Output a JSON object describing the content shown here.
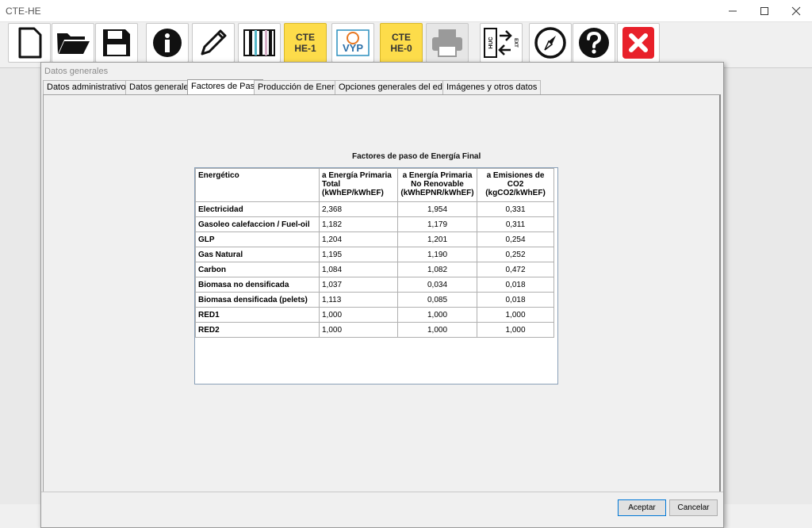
{
  "window": {
    "title": "CTE-HE"
  },
  "toolbar": {
    "cte_he1": "CTE\nHE-1",
    "cte_he0": "CTE\nHE-0",
    "vyp": "VYP",
    "huc": "HUC",
    "ext": "EXT",
    "icons": [
      "new-file-icon",
      "open-folder-icon",
      "save-icon",
      "info-icon",
      "edit-icon",
      "layers-icon",
      "cte-he1-icon",
      "vyp-icon",
      "cte-he0-icon",
      "print-icon",
      "huc-ext-icon",
      "compass-icon",
      "help-icon",
      "close-icon"
    ]
  },
  "dialog": {
    "title": "Datos generales",
    "tabs": [
      "Datos administrativos",
      "Datos generales",
      "Factores de Paso",
      "Producción de Energía",
      "Opciones generales del edificio",
      "Imágenes y otros datos"
    ],
    "active_tab": "Factores de Paso",
    "table_title": "Factores de paso de Energía Final",
    "columns": [
      "Energético",
      "a Energía Primaria Total (kWhEP/kWhEF)",
      "a Energía Primaria No Renovable (kWhEPNR/kWhEF)",
      "a Emisiones de CO2 (kgCO2/kWhEF)"
    ],
    "column_lines": [
      [
        "Energético"
      ],
      [
        "a Energía Primaria",
        "Total",
        "(kWhEP/kWhEF)"
      ],
      [
        "a Energía Primaria",
        "No Renovable",
        "(kWhEPNR/kWhEF)"
      ],
      [
        "a Emisiones de",
        "CO2",
        "(kgCO2/kWhEF)"
      ]
    ],
    "rows": [
      [
        "Electricidad",
        "2,368",
        "1,954",
        "0,331"
      ],
      [
        "Gasoleo calefaccion / Fuel-oil",
        "1,182",
        "1,179",
        "0,311"
      ],
      [
        "GLP",
        "1,204",
        "1,201",
        "0,254"
      ],
      [
        "Gas Natural",
        "1,195",
        "1,190",
        "0,252"
      ],
      [
        "Carbon",
        "1,084",
        "1,082",
        "0,472"
      ],
      [
        "Biomasa no densificada",
        "1,037",
        "0,034",
        "0,018"
      ],
      [
        "Biomasa densificada (pelets)",
        "1,113",
        "0,085",
        "0,018"
      ],
      [
        "RED1",
        "1,000",
        "1,000",
        "1,000"
      ],
      [
        "RED2",
        "1,000",
        "1,000",
        "1,000"
      ]
    ],
    "accept_label": "Aceptar",
    "cancel_label": "Cancelar"
  },
  "colors": {
    "accent_yellow": "#fddc4a",
    "close_red": "#e8202a",
    "focus_blue": "#0078d7"
  }
}
